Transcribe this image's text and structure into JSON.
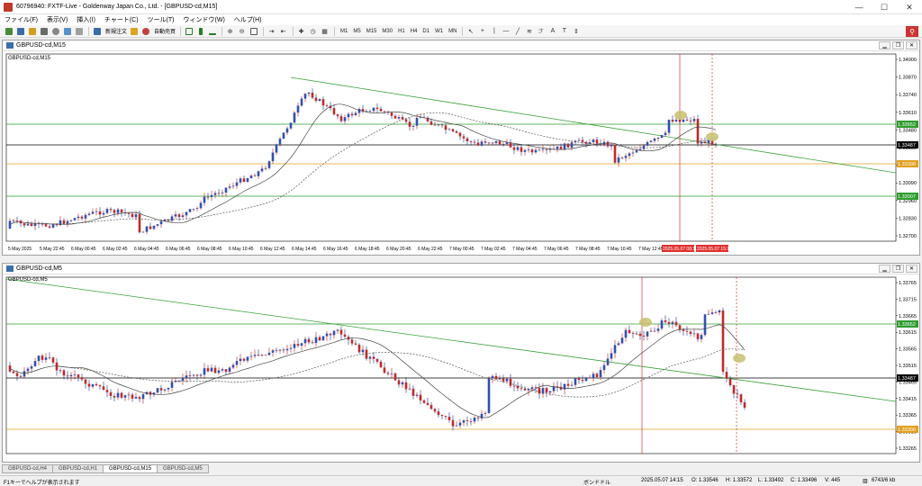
{
  "window": {
    "title": "60796940: FXTF-Live - Goldenway Japan Co., Ltd. - [GBPUSD-cd,M15]"
  },
  "menu": [
    "ファイル(F)",
    "表示(V)",
    "挿入(I)",
    "チャート(C)",
    "ツール(T)",
    "ウィンドウ(W)",
    "ヘルプ(H)"
  ],
  "toolbar": {
    "new_order": "新規注文",
    "auto_trade": "自動売買",
    "timeframes": [
      "M1",
      "M5",
      "M15",
      "M30",
      "H1",
      "H4",
      "D1",
      "W1",
      "MN"
    ]
  },
  "chart1": {
    "title": "GBPUSD-cd,M15",
    "symbol_label": "GBPUSD-cd,M15",
    "price_ticks": [
      "1.34000",
      "1.33870",
      "1.33740",
      "1.33610",
      "1.33480",
      "1.33350",
      "1.33220",
      "1.33090",
      "1.32960",
      "1.32830",
      "1.32700"
    ],
    "highlight_prices": [
      {
        "label": "1.33652",
        "color": "#2e9c2e"
      },
      {
        "label": "1.33487",
        "color": "#000000"
      },
      {
        "label": "1.33300",
        "color": "#e0a020"
      },
      {
        "label": "1.33007",
        "color": "#2e9c2e"
      }
    ],
    "time_labels": [
      "5 May 2025",
      "5 May 22:45",
      "6 May 00:45",
      "6 May 02:45",
      "6 May 04:45",
      "6 May 06:45",
      "6 May 08:45",
      "6 May 10:45",
      "6 May 12:45",
      "6 May 14:45",
      "6 May 16:45",
      "6 May 18:45",
      "6 May 20:45",
      "6 May 22:45",
      "7 May 00:45",
      "7 May 02:45",
      "7 May 04:45",
      "7 May 06:45",
      "7 May 08:45",
      "7 May 10:45",
      "7 May 12:45"
    ],
    "time_highlight": "2025.05.07 08:15",
    "time_highlight2": "2025.05.07 15:15"
  },
  "chart2": {
    "title": "GBPUSD-cd,M5",
    "symbol_label": "GBPUSD-cd,M5",
    "price_ticks": [
      "1.33765",
      "1.33715",
      "1.33665",
      "1.33615",
      "1.33565",
      "1.33515",
      "1.33465",
      "1.33415",
      "1.33365",
      "1.33315",
      "1.33265"
    ],
    "highlight_prices": [
      {
        "label": "1.33652",
        "color": "#2e9c2e"
      },
      {
        "label": "1.33487",
        "color": "#000000"
      },
      {
        "label": "1.33300",
        "color": "#e0a020"
      }
    ]
  },
  "tabs": [
    "GBPUSD-cd,H4",
    "GBPUSD-cd,H1",
    "GBPUSD-cd,M15",
    "GBPUSD-cd,M5"
  ],
  "active_tab": 2,
  "status": {
    "help": "F1キーでヘルプが表示されます",
    "profile": "ボンドドル",
    "time": "2025.05.07 14:15",
    "open": "O: 1.33546",
    "high": "H: 1.33572",
    "low": "L: 1.33492",
    "close": "C: 1.33496",
    "volume": "V: 445",
    "traffic": "6743/6 kb"
  }
}
